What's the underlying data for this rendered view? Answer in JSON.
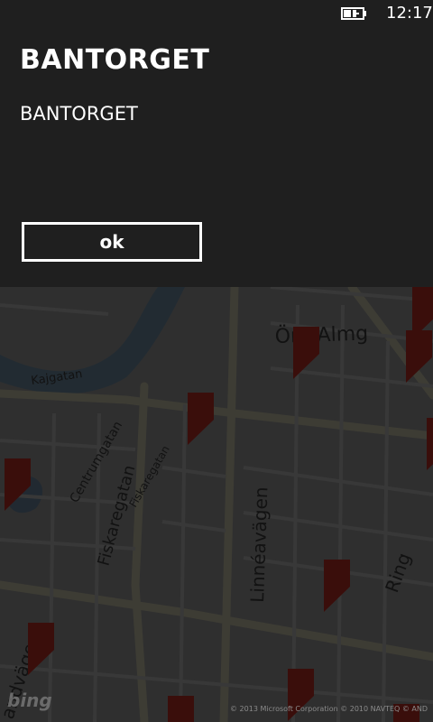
{
  "status_bar": {
    "time": "12:17"
  },
  "dialog": {
    "title": "BANTORGET",
    "message": "BANTORGET",
    "ok_label": "ok"
  },
  "map": {
    "street_labels": [
      "Kajgatan",
      "Centrumgatan",
      "Fiskaregatan",
      "Fiskaregatan",
      "Linnéavägen",
      "Öra Almg",
      "Ring",
      "andvägen"
    ],
    "logo": "bing",
    "attribution": "© 2013 Microsoft Corporation   © 2010 NAVTEQ   © AND",
    "pin_color": "#6b1a14",
    "pin_count": 11
  },
  "colors": {
    "panel": "#1f1f1f",
    "text": "#ffffff"
  }
}
